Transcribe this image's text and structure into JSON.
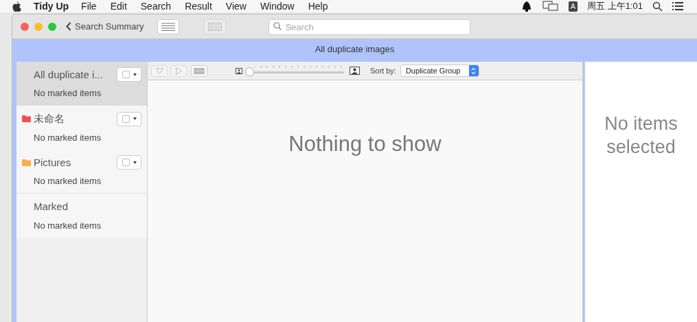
{
  "menu_bar": {
    "app": "Tidy Up",
    "items": [
      "File",
      "Edit",
      "Search",
      "Result",
      "View",
      "Window",
      "Help"
    ],
    "input_source": "A",
    "clock": "周五 上午1:01"
  },
  "window": {
    "back": "Search Summary",
    "search": {
      "placeholder": "Search"
    },
    "title": "All duplicate images"
  },
  "sidebar": {
    "items": [
      {
        "title": "All duplicate i...",
        "subtitle": "No marked items",
        "selected": true,
        "checked": false
      },
      {
        "title": "未命名",
        "subtitle": "No marked items",
        "selected": false,
        "checked": false,
        "color": "#ef5350"
      },
      {
        "title": "Pictures",
        "subtitle": "No marked items",
        "selected": false,
        "checked": false,
        "color": "#ffab4a"
      },
      {
        "title": "Marked",
        "subtitle": "No marked items",
        "selected": false
      }
    ]
  },
  "toolbar": {
    "thumbnail_size": {
      "level": 0
    },
    "sort_label": "Sort by:",
    "sort_value": "Duplicate Group"
  },
  "content": {
    "empty_text": "Nothing to show"
  },
  "detail": {
    "empty_text": "No items selected"
  }
}
